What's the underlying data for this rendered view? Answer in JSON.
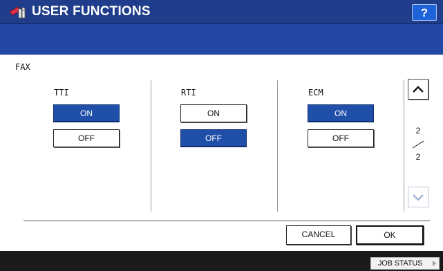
{
  "header": {
    "icon": "user-functions-icon",
    "title": "USER FUNCTIONS",
    "help_label": "?",
    "accent": "#1f3d8a"
  },
  "section_label": "FAX",
  "columns": [
    {
      "label": "TTI",
      "on_label": "ON",
      "off_label": "OFF",
      "selected": "ON"
    },
    {
      "label": "RTI",
      "on_label": "ON",
      "off_label": "OFF",
      "selected": "OFF"
    },
    {
      "label": "ECM",
      "on_label": "ON",
      "off_label": "OFF",
      "selected": "ON"
    }
  ],
  "pager": {
    "current": "2",
    "total": "2",
    "up_icon": "chevron-up-icon",
    "down_icon": "chevron-down-icon"
  },
  "actions": {
    "cancel_label": "CANCEL",
    "ok_label": "OK"
  },
  "footer": {
    "job_status_label": "JOB STATUS"
  },
  "colors": {
    "selected_button": "#1f4fa8",
    "message_bar": "#2347a6",
    "help_button": "#1e63d9"
  }
}
